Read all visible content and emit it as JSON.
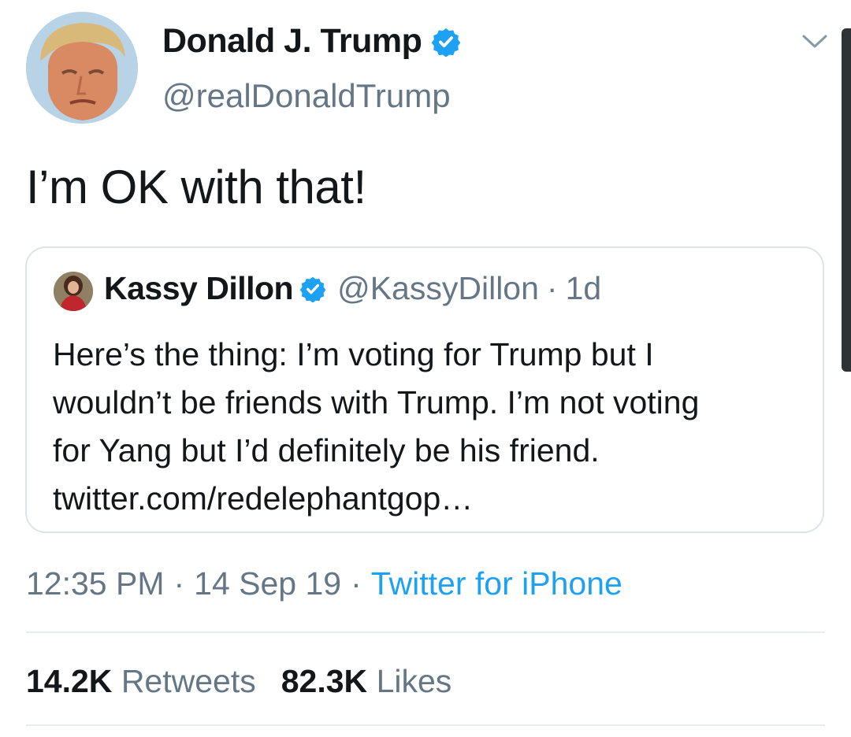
{
  "tweet": {
    "author_name": "Donald J. Trump",
    "author_handle": "@realDonaldTrump",
    "text": "I’m OK with that!",
    "time": "12:35 PM",
    "date": "14 Sep 19",
    "source": "Twitter for iPhone",
    "separator": "·"
  },
  "quoted_tweet": {
    "author_name": "Kassy Dillon",
    "author_handle": "@KassyDillon",
    "age": "1d",
    "separator": "·",
    "text_lines": [
      "Here’s the thing: I’m voting for Trump but I",
      "wouldn’t be friends with Trump. I’m not voting",
      "for Yang but I’d definitely be his friend.",
      "twitter.com/redelephantgop…"
    ]
  },
  "stats": {
    "retweets_count": "14.2K",
    "retweets_label": "Retweets",
    "likes_count": "82.3K",
    "likes_label": "Likes"
  },
  "icons": {
    "verified": "verified-badge-icon",
    "caret": "chevron-down-icon"
  },
  "colors": {
    "accent": "#1da1f2",
    "secondary_text": "#657786",
    "primary_text": "#14171a",
    "border": "#dde3e8"
  }
}
